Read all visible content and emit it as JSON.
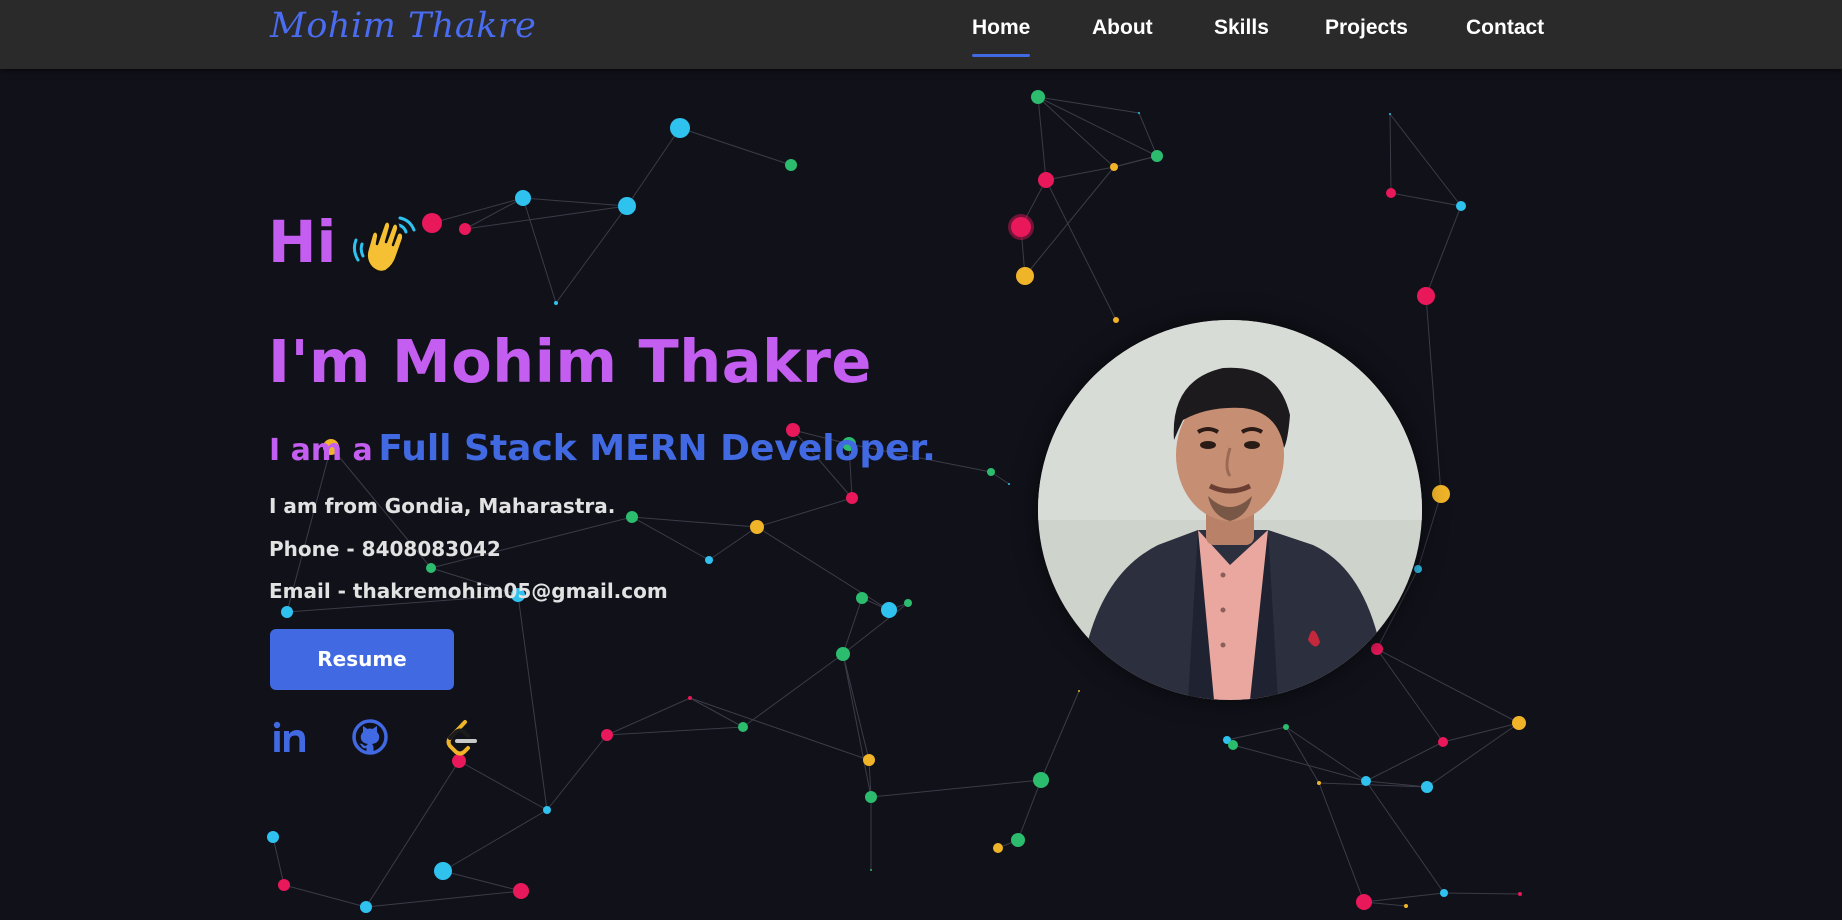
{
  "navbar": {
    "logo": "Mohim Thakre",
    "links": [
      {
        "label": "Home",
        "active": true
      },
      {
        "label": "About",
        "active": false
      },
      {
        "label": "Skills",
        "active": false
      },
      {
        "label": "Projects",
        "active": false
      },
      {
        "label": "Contact",
        "active": false
      }
    ]
  },
  "hero": {
    "greeting": "Hi",
    "greeting_icon": "waving-hand-icon",
    "name_line": "I'm Mohim Thakre",
    "role_prefix": "I am a",
    "role": "Full Stack MERN Developer.",
    "location": "I am from Gondia, Maharastra.",
    "phone": "Phone - 8408083042",
    "email": "Email - thakremohim05@gmail.com",
    "resume_label": "Resume",
    "socials": [
      {
        "icon": "linkedin-icon"
      },
      {
        "icon": "github-icon"
      },
      {
        "icon": "leetcode-icon"
      }
    ]
  },
  "colors": {
    "accent_purple": "#c45ef0",
    "accent_blue": "#4169e1",
    "background": "#11111a",
    "navbar": "#2a2a2a",
    "particles": [
      "#e8185a",
      "#2bbc6e",
      "#f0b429",
      "#2fc2ef"
    ]
  }
}
